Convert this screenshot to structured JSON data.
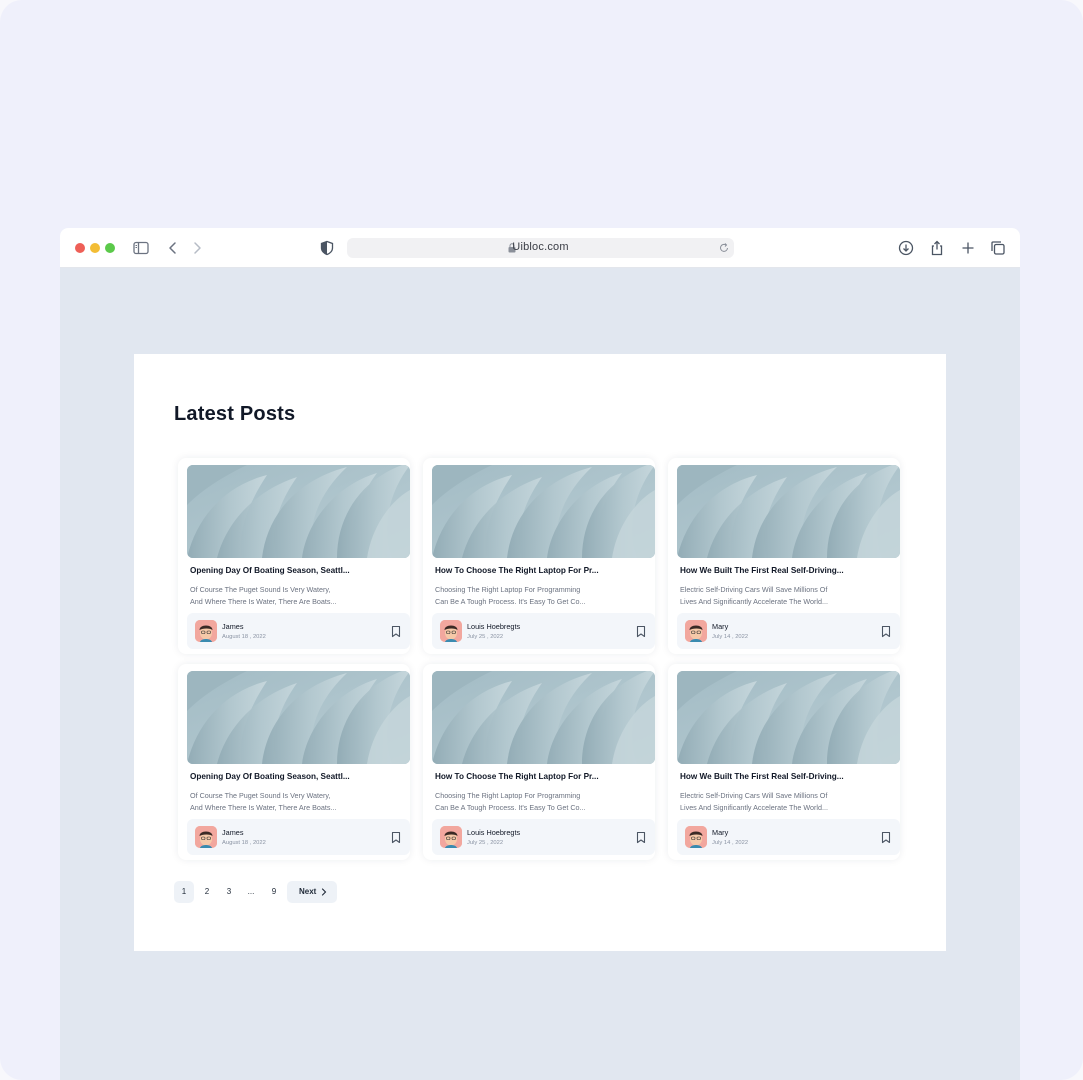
{
  "browser": {
    "url": "Uibloc.com"
  },
  "section": {
    "title": "Latest Posts"
  },
  "posts": [
    {
      "title": "Opening Day Of Boating Season, Seattl...",
      "excerpt_line1": "Of Course The Puget Sound Is Very Watery,",
      "excerpt_line2": "And Where There Is Water, There Are Boats...",
      "author": "James",
      "date": "August 18 , 2022"
    },
    {
      "title": "How To Choose The Right Laptop For Pr...",
      "excerpt_line1": "Choosing The Right Laptop For Programming",
      "excerpt_line2": "Can Be A Tough Process. It's Easy To Get Co...",
      "author": "Louis Hoebregts",
      "date": "July 25 , 2022"
    },
    {
      "title": "How We Built The First Real Self-Driving...",
      "excerpt_line1": "Electric Self-Driving Cars Will Save Millions Of",
      "excerpt_line2": "Lives And Significantly Accelerate The World...",
      "author": "Mary",
      "date": "July 14 , 2022"
    },
    {
      "title": "Opening Day Of Boating Season, Seattl...",
      "excerpt_line1": "Of Course The Puget Sound Is Very Watery,",
      "excerpt_line2": "And Where There Is Water, There Are Boats...",
      "author": "James",
      "date": "August 18 , 2022"
    },
    {
      "title": "How To Choose The Right Laptop For Pr...",
      "excerpt_line1": "Choosing The Right Laptop For Programming",
      "excerpt_line2": "Can Be A Tough Process. It's Easy To Get Co...",
      "author": "Louis Hoebregts",
      "date": "July 25 , 2022"
    },
    {
      "title": "How We Built The First Real Self-Driving...",
      "excerpt_line1": "Electric Self-Driving Cars Will Save Millions Of",
      "excerpt_line2": "Lives And Significantly Accelerate The World...",
      "author": "Mary",
      "date": "July 14 , 2022"
    }
  ],
  "pagination": {
    "pages": [
      "1",
      "2",
      "3",
      "...",
      "9"
    ],
    "current": "1",
    "next_label": "Next"
  },
  "colors": {
    "accent": "#1f2937",
    "background": "#e1e7f0",
    "frame": "#eff0fb"
  },
  "icons": {
    "sidebar": "sidebar-icon",
    "back": "chevron-left-icon",
    "forward": "chevron-right-icon",
    "privacy": "shield-icon",
    "download": "download-icon",
    "share": "share-icon",
    "new_tab": "plus-icon",
    "tabs": "tabs-icon",
    "bookmark": "bookmark-icon"
  }
}
